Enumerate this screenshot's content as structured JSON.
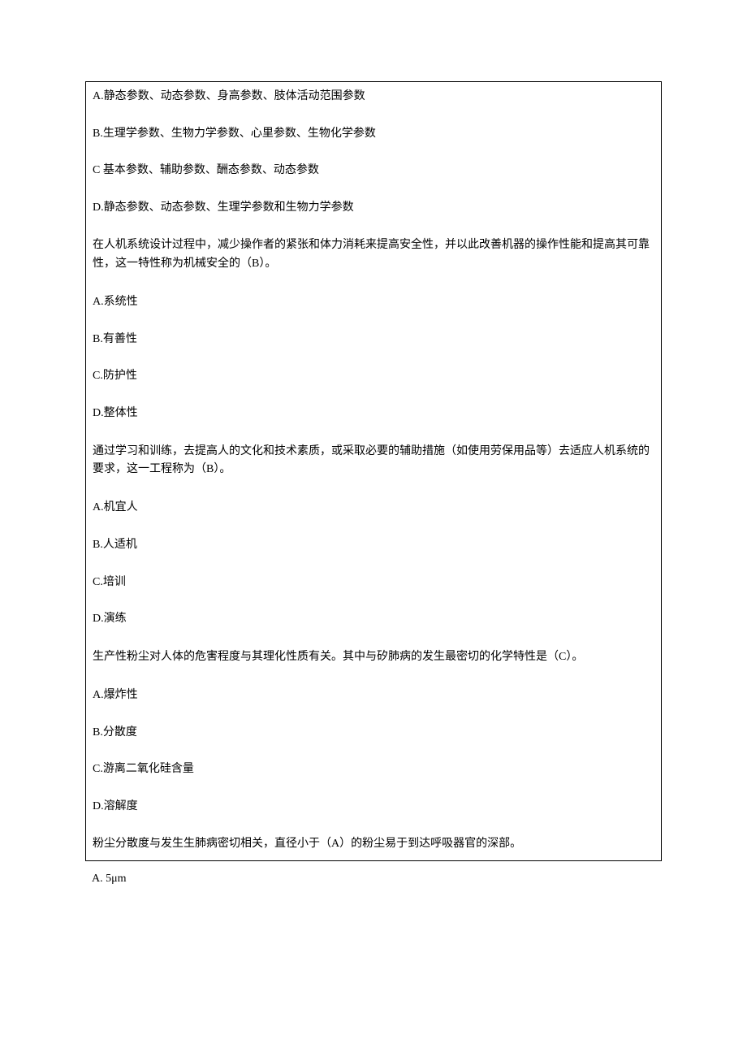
{
  "q1": {
    "optA": "A.静态参数、动态参数、身高参数、肢体活动范围参数",
    "optB": "B.生理学参数、生物力学参数、心里参数、生物化学参数",
    "optC": "C 基本参数、辅助参数、酬态参数、动态参数",
    "optD": "D.静态参数、动态参数、生理学参数和生物力学参数"
  },
  "q2": {
    "stem": "在人机系统设计过程中，减少操作者的紧张和体力消耗来提高安全性，并以此改善机器的操作性能和提高其可靠性，这一特性称为机械安全的（B）。",
    "optA": "A.系统性",
    "optB": "B.有善性",
    "optC": "C.防护性",
    "optD": "D.整体性"
  },
  "q3": {
    "stem": "通过学习和训练，去提高人的文化和技术素质，或采取必要的辅助措施（如使用劳保用品等）去适应人机系统的要求，这一工程称为（B）。",
    "optA": "A.机宜人",
    "optB": "B.人适机",
    "optC": "C.培训",
    "optD": "D.演练"
  },
  "q4": {
    "stem": "生产性粉尘对人体的危害程度与其理化性质有关。其中与矽肺病的发生最密切的化学特性是（C）。",
    "optA": "A.爆炸性",
    "optB": "B.分散度",
    "optC": "C.游离二氧化硅含量",
    "optD": "D.溶解度"
  },
  "q5": {
    "stem": "粉尘分散度与发生生肺病密切相关，直径小于（A）的粉尘易于到达呼吸器官的深部。",
    "optA": "A.  5μm"
  }
}
